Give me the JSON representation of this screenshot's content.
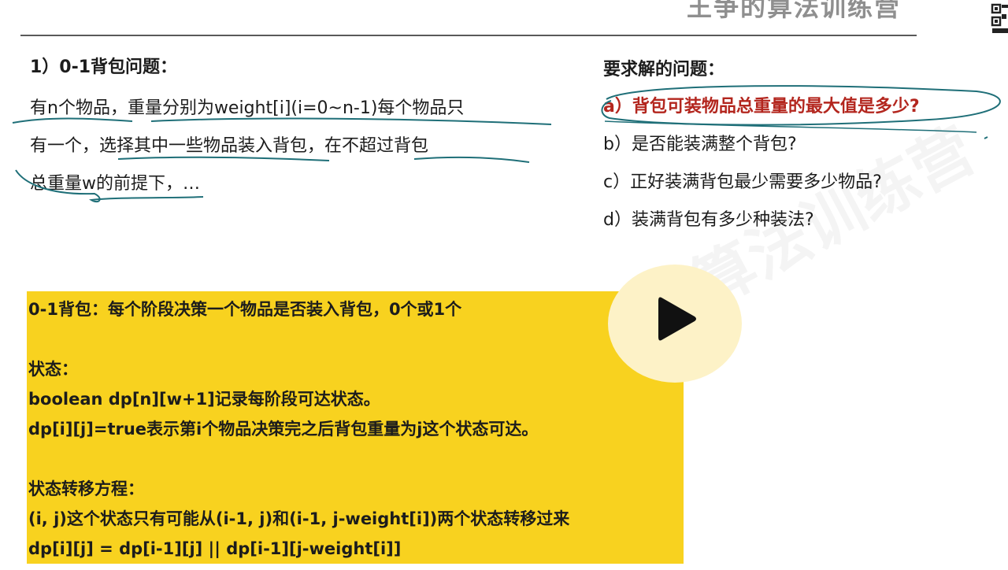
{
  "header": {
    "title": "王争的算法训练营"
  },
  "problem": {
    "heading": "1）0-1背包问题：",
    "lines": [
      "有n个物品，重量分别为weight[i](i=0~n-1)每个物品只",
      "有一个，选择其中一些物品装入背包，在不超过背包",
      "总重量w的前提下，…"
    ]
  },
  "questions": {
    "heading": "要求解的问题：",
    "items": [
      "a）背包可装物品总重量的最大值是多少?",
      "b）是否能装满整个背包?",
      "c）正好装满背包最少需要多少物品?",
      "d）装满背包有多少种装法?"
    ]
  },
  "summary_box": {
    "line1": "0-1背包：每个阶段决策一个物品是否装入背包，0个或1个",
    "state_heading": "状态：",
    "state_line1": "boolean dp[n][w+1]记录每阶段可达状态。",
    "state_line2": "dp[i][j]=true表示第i个物品决策完之后背包重量为j这个状态可达。",
    "transition_heading": "状态转移方程：",
    "transition_line1": "(i, j)这个状态只有可能从(i-1, j)和(i-1, j-weight[i])两个状态转移过来",
    "transition_line2": "dp[i][j]  = dp[i-1][j] || dp[i-1][j-weight[i]]"
  },
  "colors": {
    "highlight_box": "#f8d21f",
    "annotation_ink": "#1f6f78",
    "highlight_text": "#b3261e"
  },
  "icons": {
    "play": "play-icon",
    "qr": "qr-code-icon"
  }
}
